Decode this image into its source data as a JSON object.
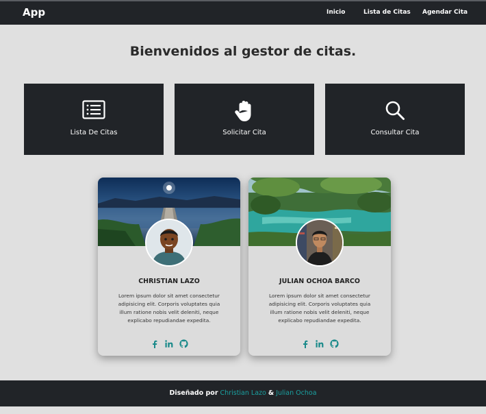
{
  "navbar": {
    "brand": "App",
    "links": [
      "Inicio",
      "Lista de Citas",
      "Agendar Cita"
    ]
  },
  "main": {
    "title": "Bienvenidos al gestor de citas.",
    "tiles": [
      {
        "label": "Lista De Citas",
        "icon": "list-icon"
      },
      {
        "label": "Solicitar Cita",
        "icon": "hand-icon"
      },
      {
        "label": "Consultar Cita",
        "icon": "search-icon"
      }
    ]
  },
  "cards": [
    {
      "name": "CHRISTIAN LAZO",
      "desc": "Lorem ipsum dolor sit amet consectetur adipisicing elit. Corporis voluptates quia illum ratione nobis velit deleniti, neque explicabo repudiandae expedita.",
      "socials": [
        "facebook-icon",
        "linkedin-icon",
        "github-icon"
      ]
    },
    {
      "name": "JULIAN OCHOA BARCO",
      "desc": "Lorem ipsum dolor sit amet consectetur adipisicing elit. Corporis voluptates quia illum ratione nobis velit deleniti, neque explicabo repudiandae expedita.",
      "socials": [
        "facebook-icon",
        "linkedin-icon",
        "github-icon"
      ]
    }
  ],
  "footer": {
    "prefix": "Diseñado por",
    "author1": "Christian Lazo",
    "amp": "&",
    "author2": "Julian Ochoa"
  },
  "colors": {
    "dark": "#212428",
    "background": "#e0e0e0",
    "accent": "#1a8a8a",
    "footer_link": "#1aa1a1"
  }
}
